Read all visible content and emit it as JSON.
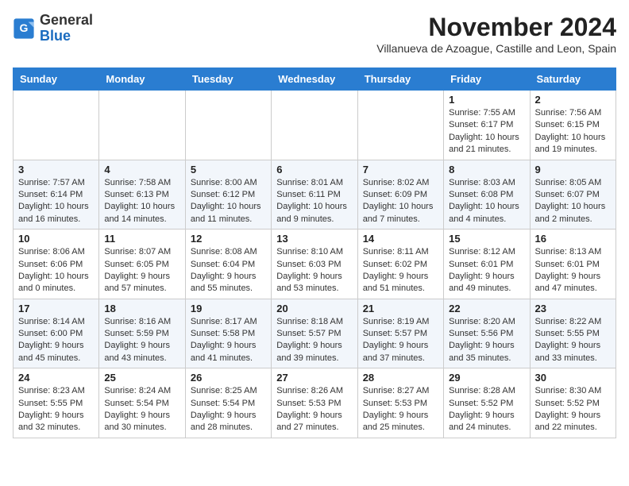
{
  "logo": {
    "general": "General",
    "blue": "Blue"
  },
  "title": "November 2024",
  "subtitle": "Villanueva de Azoague, Castille and Leon, Spain",
  "headers": [
    "Sunday",
    "Monday",
    "Tuesday",
    "Wednesday",
    "Thursday",
    "Friday",
    "Saturday"
  ],
  "weeks": [
    [
      {
        "day": "",
        "info": ""
      },
      {
        "day": "",
        "info": ""
      },
      {
        "day": "",
        "info": ""
      },
      {
        "day": "",
        "info": ""
      },
      {
        "day": "",
        "info": ""
      },
      {
        "day": "1",
        "info": "Sunrise: 7:55 AM\nSunset: 6:17 PM\nDaylight: 10 hours\nand 21 minutes."
      },
      {
        "day": "2",
        "info": "Sunrise: 7:56 AM\nSunset: 6:15 PM\nDaylight: 10 hours\nand 19 minutes."
      }
    ],
    [
      {
        "day": "3",
        "info": "Sunrise: 7:57 AM\nSunset: 6:14 PM\nDaylight: 10 hours\nand 16 minutes."
      },
      {
        "day": "4",
        "info": "Sunrise: 7:58 AM\nSunset: 6:13 PM\nDaylight: 10 hours\nand 14 minutes."
      },
      {
        "day": "5",
        "info": "Sunrise: 8:00 AM\nSunset: 6:12 PM\nDaylight: 10 hours\nand 11 minutes."
      },
      {
        "day": "6",
        "info": "Sunrise: 8:01 AM\nSunset: 6:11 PM\nDaylight: 10 hours\nand 9 minutes."
      },
      {
        "day": "7",
        "info": "Sunrise: 8:02 AM\nSunset: 6:09 PM\nDaylight: 10 hours\nand 7 minutes."
      },
      {
        "day": "8",
        "info": "Sunrise: 8:03 AM\nSunset: 6:08 PM\nDaylight: 10 hours\nand 4 minutes."
      },
      {
        "day": "9",
        "info": "Sunrise: 8:05 AM\nSunset: 6:07 PM\nDaylight: 10 hours\nand 2 minutes."
      }
    ],
    [
      {
        "day": "10",
        "info": "Sunrise: 8:06 AM\nSunset: 6:06 PM\nDaylight: 10 hours\nand 0 minutes."
      },
      {
        "day": "11",
        "info": "Sunrise: 8:07 AM\nSunset: 6:05 PM\nDaylight: 9 hours\nand 57 minutes."
      },
      {
        "day": "12",
        "info": "Sunrise: 8:08 AM\nSunset: 6:04 PM\nDaylight: 9 hours\nand 55 minutes."
      },
      {
        "day": "13",
        "info": "Sunrise: 8:10 AM\nSunset: 6:03 PM\nDaylight: 9 hours\nand 53 minutes."
      },
      {
        "day": "14",
        "info": "Sunrise: 8:11 AM\nSunset: 6:02 PM\nDaylight: 9 hours\nand 51 minutes."
      },
      {
        "day": "15",
        "info": "Sunrise: 8:12 AM\nSunset: 6:01 PM\nDaylight: 9 hours\nand 49 minutes."
      },
      {
        "day": "16",
        "info": "Sunrise: 8:13 AM\nSunset: 6:01 PM\nDaylight: 9 hours\nand 47 minutes."
      }
    ],
    [
      {
        "day": "17",
        "info": "Sunrise: 8:14 AM\nSunset: 6:00 PM\nDaylight: 9 hours\nand 45 minutes."
      },
      {
        "day": "18",
        "info": "Sunrise: 8:16 AM\nSunset: 5:59 PM\nDaylight: 9 hours\nand 43 minutes."
      },
      {
        "day": "19",
        "info": "Sunrise: 8:17 AM\nSunset: 5:58 PM\nDaylight: 9 hours\nand 41 minutes."
      },
      {
        "day": "20",
        "info": "Sunrise: 8:18 AM\nSunset: 5:57 PM\nDaylight: 9 hours\nand 39 minutes."
      },
      {
        "day": "21",
        "info": "Sunrise: 8:19 AM\nSunset: 5:57 PM\nDaylight: 9 hours\nand 37 minutes."
      },
      {
        "day": "22",
        "info": "Sunrise: 8:20 AM\nSunset: 5:56 PM\nDaylight: 9 hours\nand 35 minutes."
      },
      {
        "day": "23",
        "info": "Sunrise: 8:22 AM\nSunset: 5:55 PM\nDaylight: 9 hours\nand 33 minutes."
      }
    ],
    [
      {
        "day": "24",
        "info": "Sunrise: 8:23 AM\nSunset: 5:55 PM\nDaylight: 9 hours\nand 32 minutes."
      },
      {
        "day": "25",
        "info": "Sunrise: 8:24 AM\nSunset: 5:54 PM\nDaylight: 9 hours\nand 30 minutes."
      },
      {
        "day": "26",
        "info": "Sunrise: 8:25 AM\nSunset: 5:54 PM\nDaylight: 9 hours\nand 28 minutes."
      },
      {
        "day": "27",
        "info": "Sunrise: 8:26 AM\nSunset: 5:53 PM\nDaylight: 9 hours\nand 27 minutes."
      },
      {
        "day": "28",
        "info": "Sunrise: 8:27 AM\nSunset: 5:53 PM\nDaylight: 9 hours\nand 25 minutes."
      },
      {
        "day": "29",
        "info": "Sunrise: 8:28 AM\nSunset: 5:52 PM\nDaylight: 9 hours\nand 24 minutes."
      },
      {
        "day": "30",
        "info": "Sunrise: 8:30 AM\nSunset: 5:52 PM\nDaylight: 9 hours\nand 22 minutes."
      }
    ]
  ]
}
